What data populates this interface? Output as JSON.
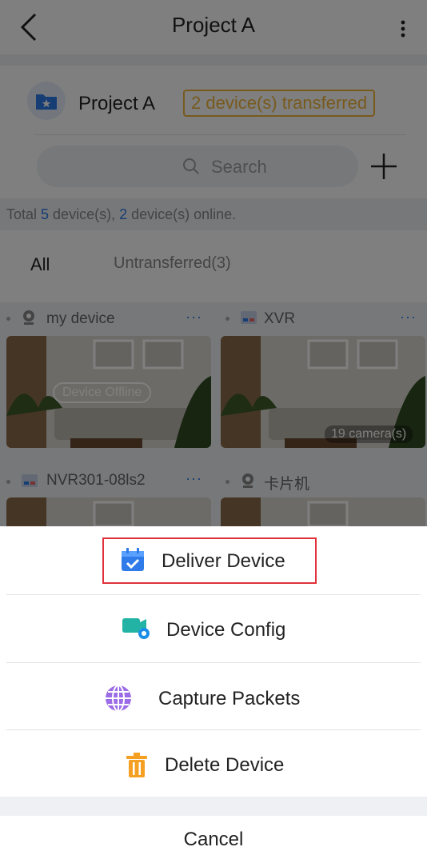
{
  "nav": {
    "title": "Project A"
  },
  "project": {
    "name": "Project A",
    "badge": "2 device(s) transferred"
  },
  "search": {
    "placeholder": "Search"
  },
  "summary": {
    "prefix": "Total ",
    "total": "5",
    "mid": " device(s), ",
    "online": "2",
    "suffix": " device(s) online."
  },
  "tabs": [
    {
      "label": "All"
    },
    {
      "label": "Untransferred(3)"
    }
  ],
  "devices": [
    {
      "name": "my device",
      "more": "···",
      "overlay": "Device Offline"
    },
    {
      "name": "XVR",
      "more": "···",
      "overlay": "19 camera(s)"
    },
    {
      "name": "NVR301-08ls2",
      "more": "···"
    },
    {
      "name": "卡片机",
      "more": ""
    }
  ],
  "sheet": {
    "items": [
      {
        "label": "Deliver Device",
        "icon": "calendar-check-icon"
      },
      {
        "label": "Device Config",
        "icon": "camera-gear-icon"
      },
      {
        "label": "Capture Packets",
        "icon": "globe-icon"
      },
      {
        "label": "Delete Device",
        "icon": "trash-icon"
      }
    ],
    "cancel": "Cancel"
  },
  "colors": {
    "accent": "#2f7bea",
    "badge": "#f0b43a",
    "highlight": "#e0313a"
  }
}
